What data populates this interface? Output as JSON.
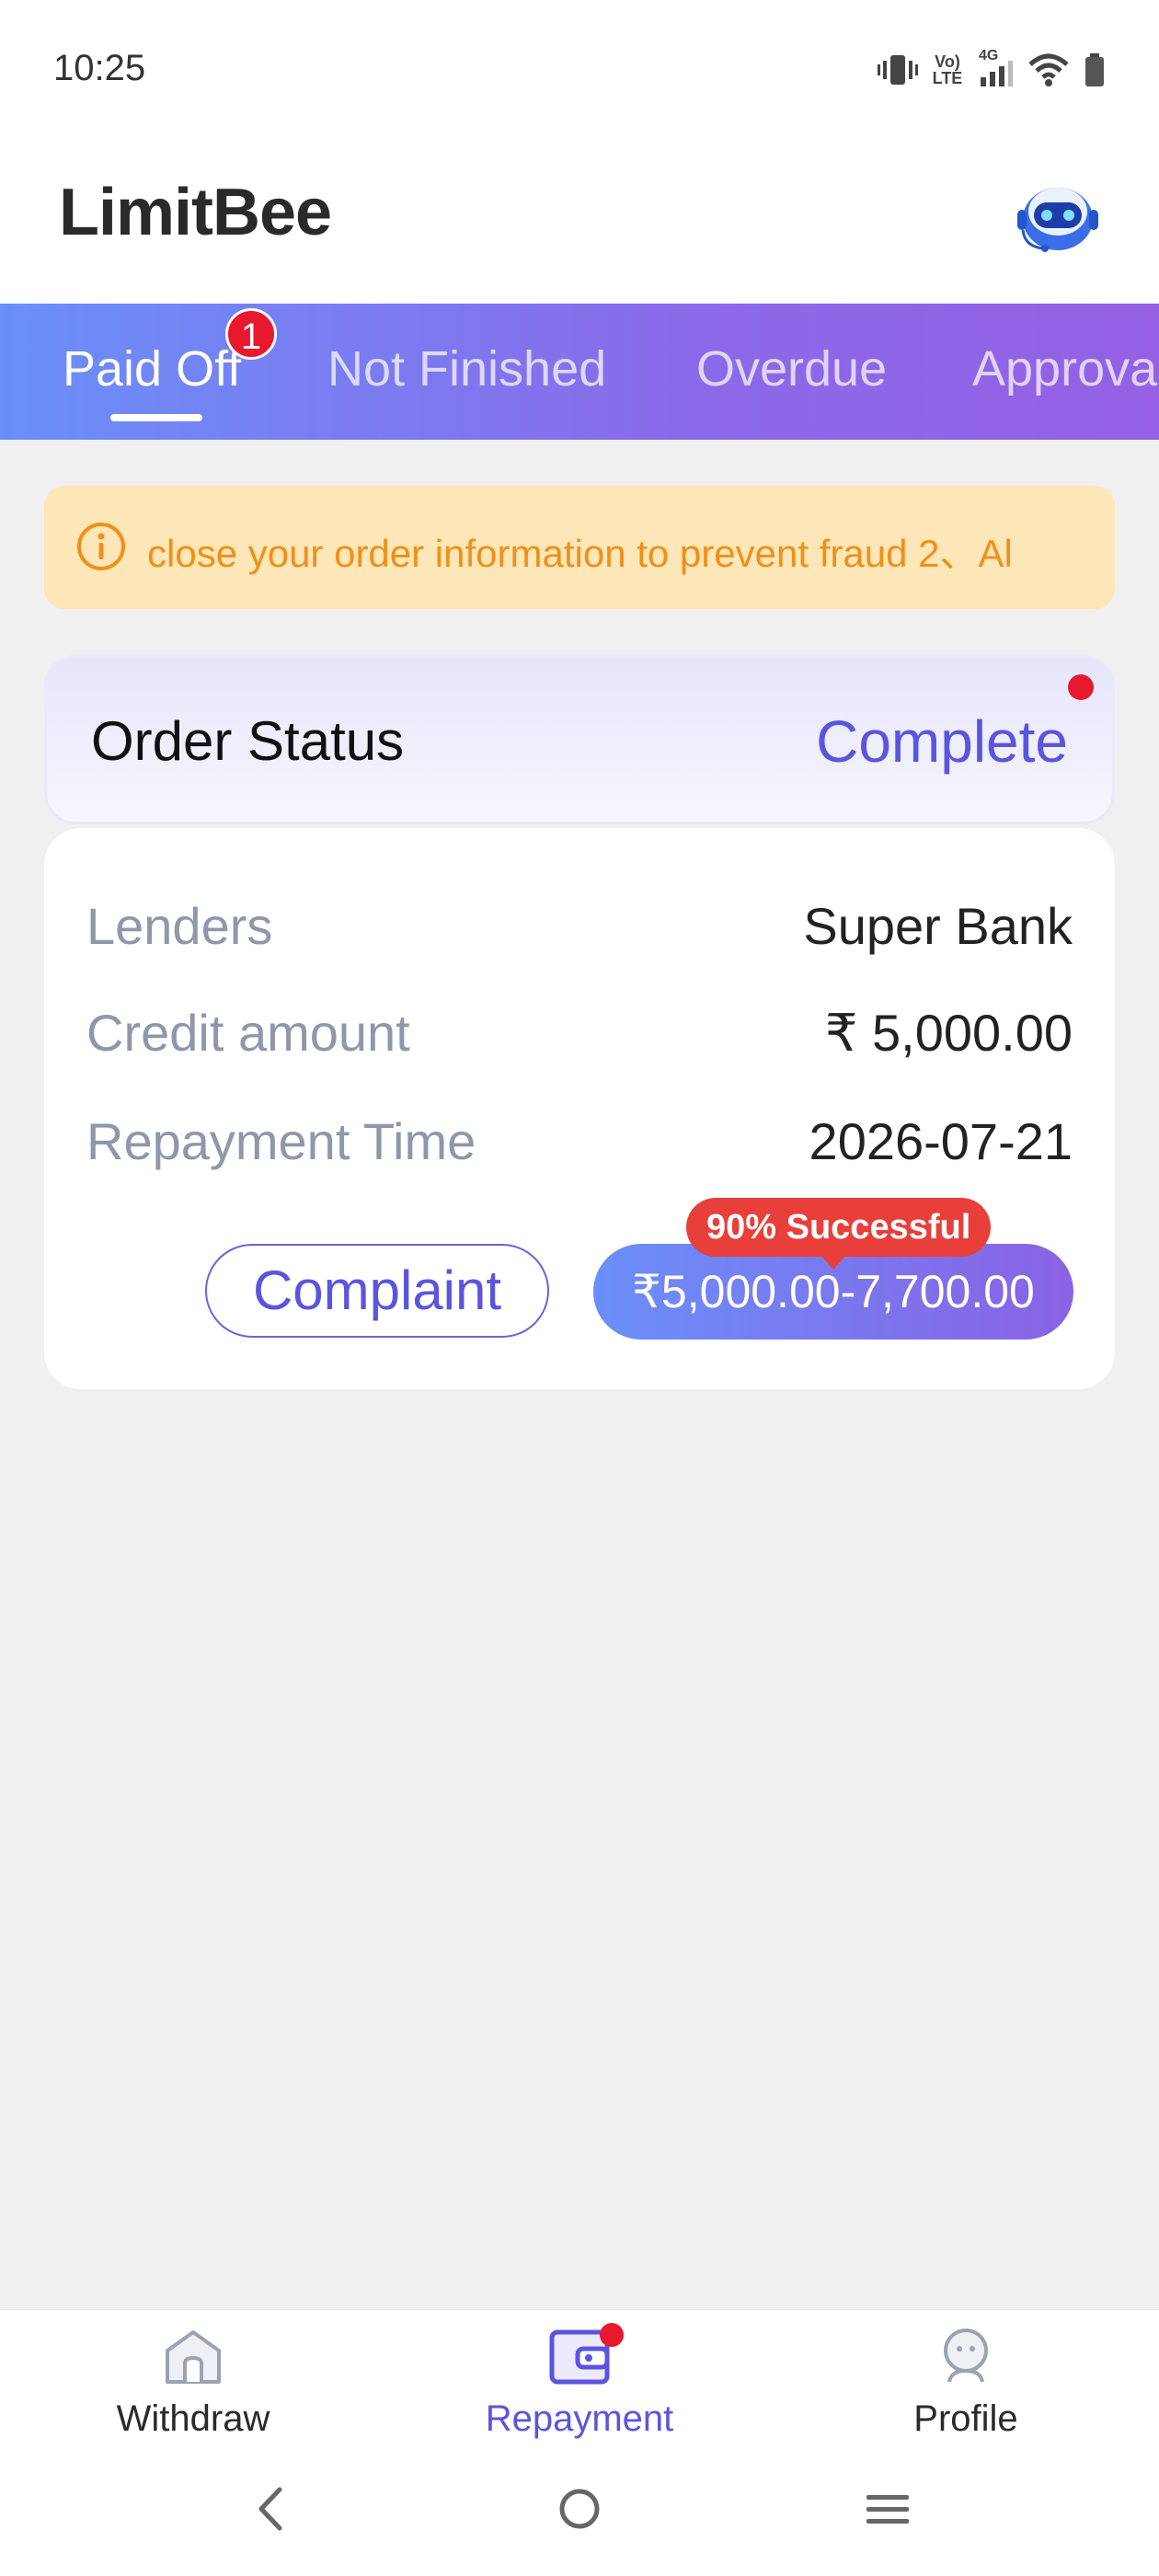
{
  "status_bar": {
    "time": "10:25",
    "icons": [
      "vibrate-icon",
      "volte-icon",
      "signal-4g-icon",
      "wifi-icon",
      "battery-icon"
    ],
    "network_labels": [
      "Vo) LTE",
      "4G"
    ]
  },
  "header": {
    "title": "LimitBee",
    "support_icon": "robot-support-icon"
  },
  "tabs": [
    {
      "label": "Paid Off",
      "active": true,
      "badge": "1"
    },
    {
      "label": "Not Finished",
      "active": false
    },
    {
      "label": "Overdue",
      "active": false
    },
    {
      "label": "Approva",
      "active": false
    }
  ],
  "notice": {
    "icon": "info-icon",
    "text": "close your order information to prevent fraud 2、Al"
  },
  "order_status": {
    "label": "Order Status",
    "value": "Complete"
  },
  "details": {
    "rows": [
      {
        "label": "Lenders",
        "value": "Super Bank"
      },
      {
        "label": "Credit amount",
        "value": "₹ 5,000.00"
      },
      {
        "label": "Repayment Time",
        "value": "2026-07-21"
      }
    ],
    "complaint_label": "Complaint",
    "amount_button_label": "₹5,000.00-7,700.00",
    "success_tag": "90% Successful"
  },
  "bottom_nav": [
    {
      "label": "Withdraw",
      "icon": "home-icon",
      "active": false
    },
    {
      "label": "Repayment",
      "icon": "wallet-icon",
      "active": true
    },
    {
      "label": "Profile",
      "icon": "profile-icon",
      "active": false
    }
  ],
  "colors": {
    "accent": "#5a55df",
    "tab_gradient_start": "#6a8ff8",
    "tab_gradient_end": "#9560e4",
    "notice_bg": "#fde6b7",
    "notice_text": "#f09018",
    "badge_red": "#e8182d"
  }
}
